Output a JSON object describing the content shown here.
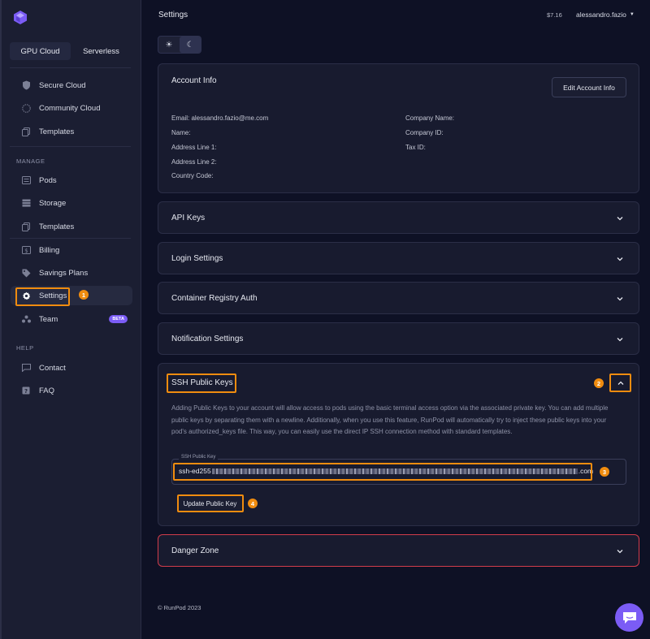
{
  "sidebar": {
    "tabs": [
      {
        "label": "GPU Cloud"
      },
      {
        "label": "Serverless"
      }
    ],
    "items_top": [
      {
        "label": "Secure Cloud",
        "icon": "shield-icon"
      },
      {
        "label": "Community Cloud",
        "icon": "globe-icon"
      },
      {
        "label": "Templates",
        "icon": "copy-icon"
      }
    ],
    "manage_label": "MANAGE",
    "items_manage": [
      {
        "label": "Pods",
        "icon": "list-icon"
      },
      {
        "label": "Storage",
        "icon": "database-icon"
      },
      {
        "label": "Templates",
        "icon": "copy-icon"
      }
    ],
    "items_billing": [
      {
        "label": "Billing",
        "icon": "dollar-icon"
      },
      {
        "label": "Savings Plans",
        "icon": "tag-icon"
      },
      {
        "label": "Settings",
        "icon": "gear-icon"
      },
      {
        "label": "Team",
        "icon": "team-icon",
        "badge": "BETA"
      }
    ],
    "help_label": "HELP",
    "items_help": [
      {
        "label": "Contact",
        "icon": "chat-icon"
      },
      {
        "label": "FAQ",
        "icon": "question-icon"
      }
    ],
    "annotation_1": "1"
  },
  "header": {
    "title": "Settings",
    "balance": "$7.16",
    "user": "alessandro.fazio"
  },
  "account": {
    "title": "Account Info",
    "edit_button": "Edit Account Info",
    "left_fields": [
      "Email: alessandro.fazio@me.com",
      "Name:",
      "Address Line 1:",
      "Address Line 2:",
      "Country Code:"
    ],
    "right_fields": [
      "Company Name:",
      "Company ID:",
      "Tax ID:"
    ]
  },
  "sections": [
    {
      "title": "API Keys"
    },
    {
      "title": "Login Settings"
    },
    {
      "title": "Container Registry Auth"
    },
    {
      "title": "Notification Settings"
    }
  ],
  "ssh": {
    "title": "SSH Public Keys",
    "description": "Adding Public Keys to your account will allow access to pods using the basic terminal access option via the associated private key. You can add multiple public keys by separating them with a newline. Additionally, when you use this feature, RunPod will automatically try to inject these public keys into your pod's authorized_keys file. This way, you can easily use the direct IP SSH connection method with standard templates.",
    "field_label": "SSH Public Key",
    "value_start": "ssh-ed255",
    "value_end": ".com",
    "button": "Update Public Key",
    "annotation_2": "2",
    "annotation_3": "3",
    "annotation_4": "4"
  },
  "danger": {
    "title": "Danger Zone",
    "color": "#d23c4b"
  },
  "footer": {
    "text": "© RunPod 2023"
  },
  "colors": {
    "accent": "#7b5cf5",
    "highlight": "#f08c0f",
    "background": "#0e1125",
    "sidebar": "#1b1e32"
  }
}
